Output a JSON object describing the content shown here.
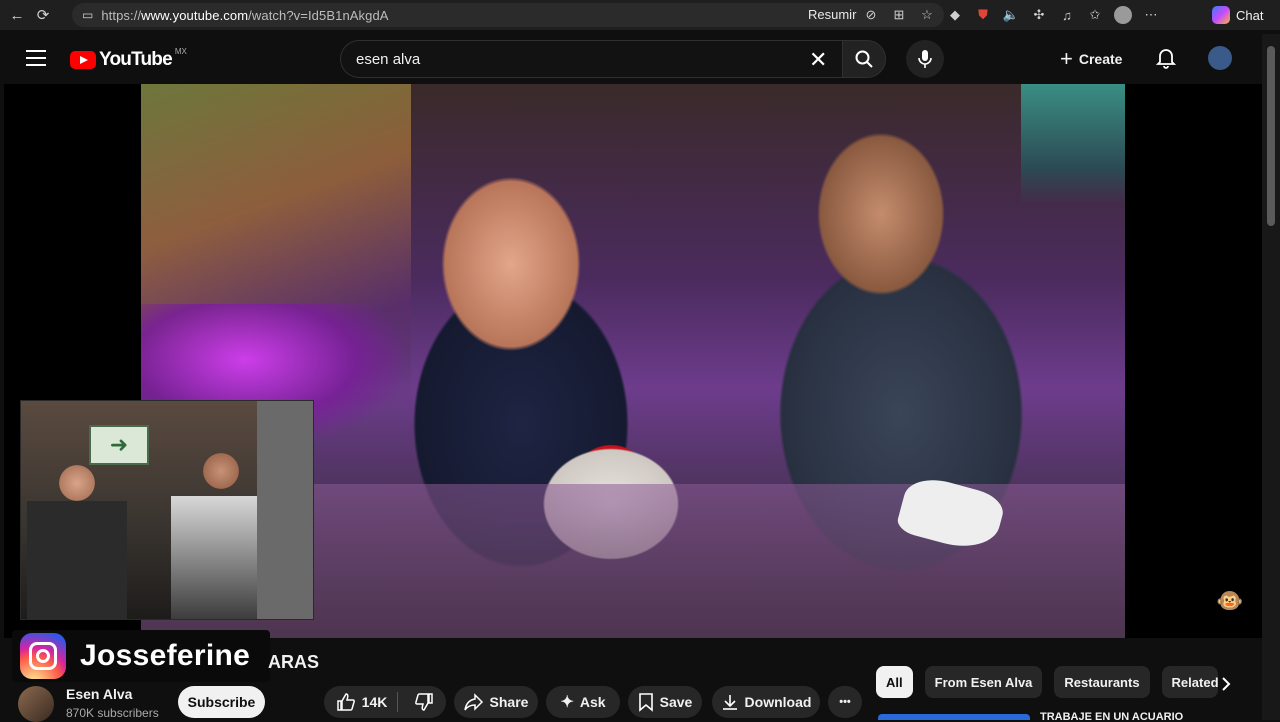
{
  "browser": {
    "url_prefix": "https://",
    "url_domain": "www.youtube.com",
    "url_path": "/watch?v=Id5B1nAkgdA",
    "resumir_label": "Resumir",
    "chat_label": "Chat"
  },
  "header": {
    "logo_text": "YouTube",
    "region": "MX",
    "search_value": "esen alva",
    "create_label": "Create"
  },
  "overlay": {
    "instagram_handle": "Josseferine",
    "title_tail": "ARAS"
  },
  "channel": {
    "name": "Esen Alva",
    "subscribers": "870K subscribers",
    "subscribe_label": "Subscribe"
  },
  "actions": {
    "like_count": "14K",
    "share_label": "Share",
    "ask_label": "Ask",
    "save_label": "Save",
    "download_label": "Download",
    "more_label": "•••"
  },
  "chips": [
    {
      "label": "All",
      "active": true
    },
    {
      "label": "From Esen Alva",
      "active": false
    },
    {
      "label": "Restaurants",
      "active": false
    },
    {
      "label": "Related",
      "active": false
    }
  ],
  "recommendation": {
    "title": "TRABAJE EN UN ACUARIO"
  },
  "colors": {
    "yt_red": "#ff0000",
    "background": "#0f0f0f",
    "pill_bg": "#272727"
  }
}
